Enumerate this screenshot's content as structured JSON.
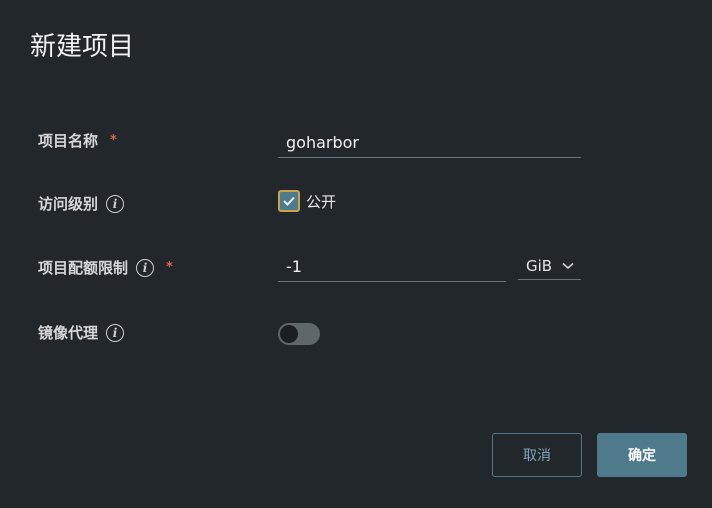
{
  "dialog": {
    "title": "新建项目"
  },
  "form": {
    "project_name": {
      "label": "项目名称",
      "required_mark": "*",
      "value": "goharbor"
    },
    "access_level": {
      "label": "访问级别",
      "checkbox_label": "公开",
      "checked": true
    },
    "quota": {
      "label": "项目配额限制",
      "required_mark": "*",
      "value": "-1",
      "unit": "GiB"
    },
    "proxy_cache": {
      "label": "镜像代理",
      "enabled": false
    }
  },
  "buttons": {
    "cancel": "取消",
    "ok": "确定"
  },
  "colors": {
    "background": "#21272b",
    "accent": "#4f7a8c",
    "required": "#e0624b"
  }
}
